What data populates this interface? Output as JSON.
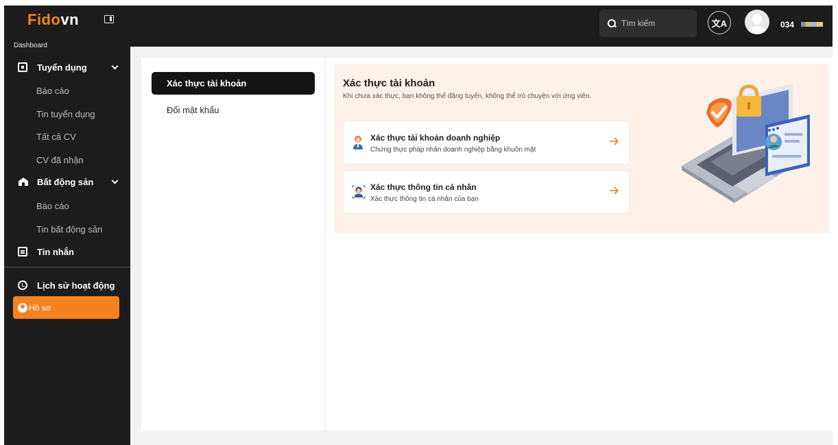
{
  "header": {
    "logo_main": "Fido",
    "logo_suffix": "vn",
    "search_placeholder": "Tìm kiếm",
    "lang_label": "文A",
    "phone": "034"
  },
  "sidebar": {
    "section": "Dashboard",
    "groups": [
      {
        "label": "Tuyển dụng",
        "icon": "recruit-icon",
        "items": [
          "Báo cáo",
          "Tin tuyển dụng",
          "Tất cả CV",
          "CV đã nhận"
        ]
      },
      {
        "label": "Bất động sản",
        "icon": "house-icon",
        "items": [
          "Báo cáo",
          "Tin bất động sản"
        ]
      },
      {
        "label": "Tin nhắn",
        "icon": "chat-icon",
        "items": []
      }
    ],
    "bottom": [
      {
        "label": "Lịch sử hoạt động",
        "icon": "history-icon"
      },
      {
        "label": "Hồ sơ",
        "icon": "profile-icon",
        "active": true
      }
    ]
  },
  "tabs": [
    {
      "label": "Xác thực tài khoản",
      "active": true
    },
    {
      "label": "Đổi mật khẩu",
      "active": false
    }
  ],
  "verify": {
    "title": "Xác thực tài khoản",
    "subtitle": "Khi chưa xác thực, bạn không thể đăng tuyển, không thể trò chuyện với ứng viên.",
    "cards": [
      {
        "title": "Xác thực tài khoản doanh nghiệp",
        "desc": "Chứng thực pháp nhân doanh nghiệp bằng khuôn mặt",
        "icon": "business-person-icon"
      },
      {
        "title": "Xác thực thông tin cá nhân",
        "desc": "Xác thực thông tin cá nhân của bạn",
        "icon": "face-scan-icon"
      }
    ]
  },
  "colors": {
    "accent": "#f5821f",
    "dark": "#1c1c1c",
    "panel_bg": "#fdf1ea"
  }
}
